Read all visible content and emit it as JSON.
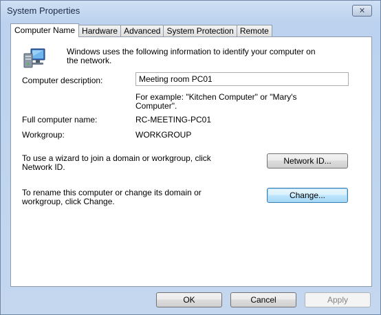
{
  "window": {
    "title": "System Properties",
    "close_glyph": "✕"
  },
  "tabs": [
    {
      "label": "Computer Name",
      "active": true
    },
    {
      "label": "Hardware"
    },
    {
      "label": "Advanced"
    },
    {
      "label": "System Protection"
    },
    {
      "label": "Remote"
    }
  ],
  "intro": {
    "line1": "Windows uses the following information to identify your computer on",
    "line2": "the network.",
    "icon": "computer-network-icon"
  },
  "description": {
    "label": "Computer description:",
    "value": "Meeting room PC01",
    "example_line1": "For example: \"Kitchen Computer\" or \"Mary's",
    "example_line2": "Computer\"."
  },
  "full_name": {
    "label": "Full computer name:",
    "value": "RC-MEETING-PC01"
  },
  "workgroup": {
    "label": "Workgroup:",
    "value": "WORKGROUP"
  },
  "network_id": {
    "text_line1": "To use a wizard to join a domain or workgroup, click",
    "text_line2": "Network ID.",
    "button": "Network ID..."
  },
  "change": {
    "text_line1": "To rename this computer or change its domain or",
    "text_line2": "workgroup, click Change.",
    "button": "Change..."
  },
  "footer": {
    "ok": "OK",
    "cancel": "Cancel",
    "apply": "Apply"
  },
  "colors": {
    "accent": "#3c7fb1",
    "titlebar": "#c4d7ef"
  }
}
